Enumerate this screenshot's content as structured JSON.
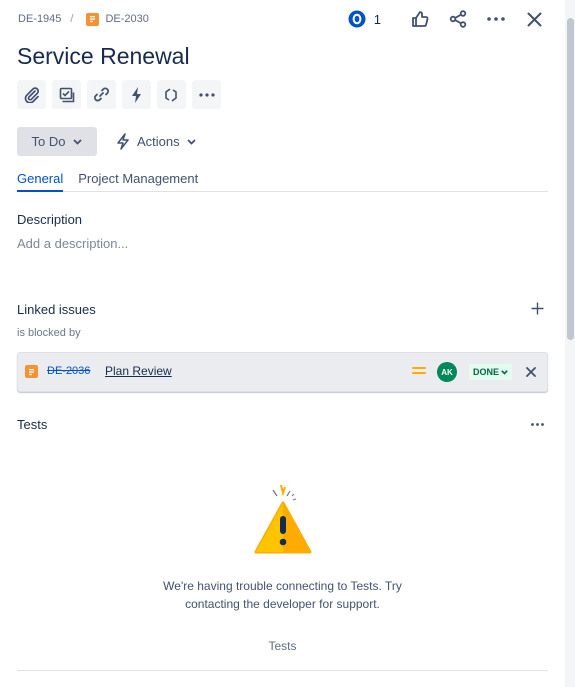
{
  "breadcrumb": {
    "parent": "DE-1945",
    "separator": "/",
    "current": "DE-2030"
  },
  "header": {
    "watch_count": "1"
  },
  "title": "Service Renewal",
  "status": {
    "label": "To Do"
  },
  "actions": {
    "label": "Actions"
  },
  "tabs": [
    {
      "label": "General",
      "active": true
    },
    {
      "label": "Project Management",
      "active": false
    }
  ],
  "description": {
    "heading": "Description",
    "placeholder": "Add a description..."
  },
  "linked_issues": {
    "heading": "Linked issues",
    "relation": "is blocked by",
    "items": [
      {
        "key": "DE-2036",
        "summary": "Plan Review",
        "assignee_initials": "AK",
        "status": "DONE"
      }
    ]
  },
  "tests": {
    "heading": "Tests",
    "error_line1": "We're having trouble connecting to Tests. Try",
    "error_line2": "contacting the developer for support.",
    "footer": "Tests"
  },
  "colors": {
    "accent": "#0052cc",
    "story": "#f79232",
    "done_bg": "#e3fcef",
    "done_text": "#006644",
    "warning": "#ffab00",
    "avatar": "#00875a"
  }
}
